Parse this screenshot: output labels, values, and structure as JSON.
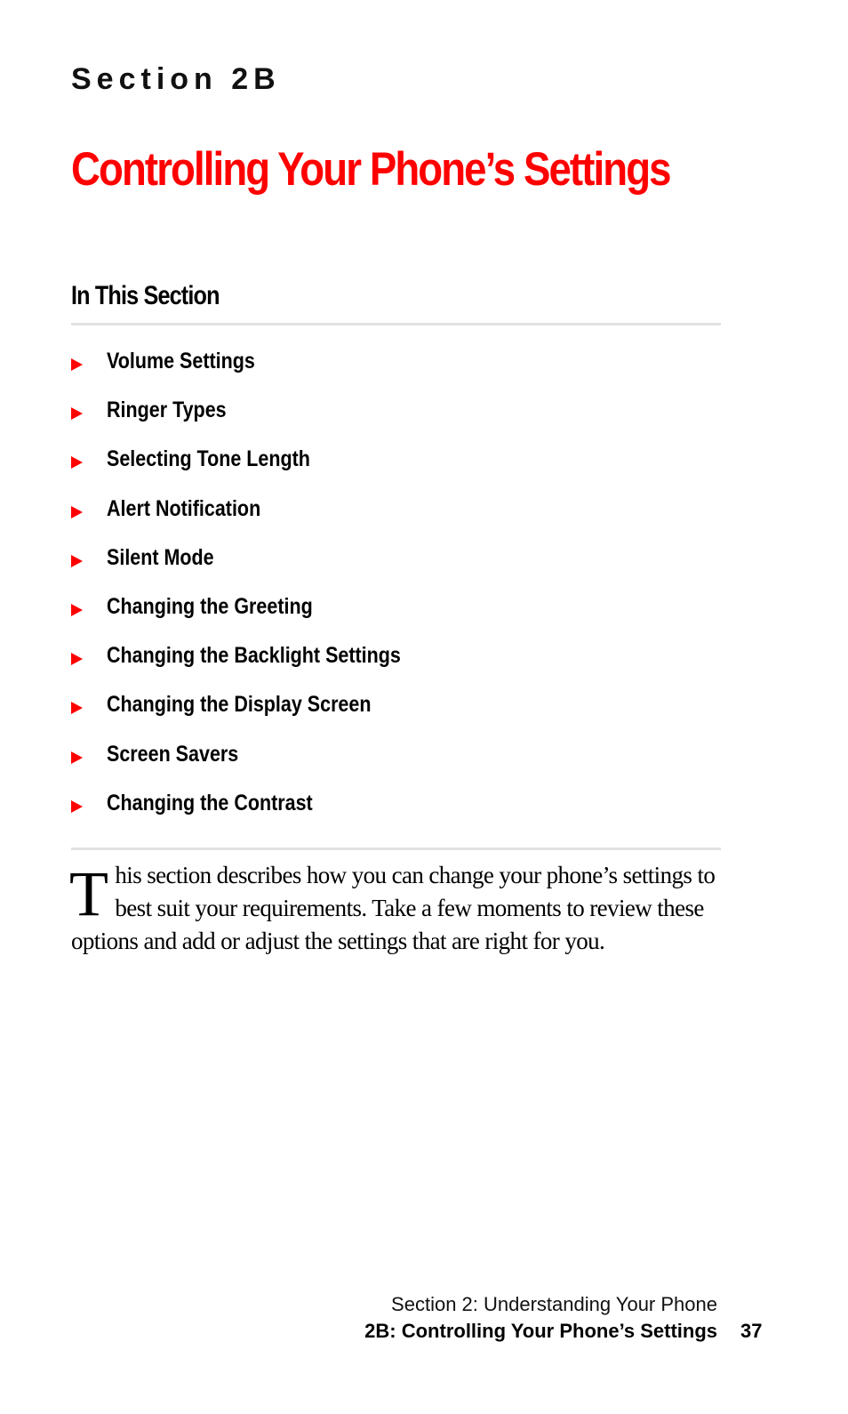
{
  "header": {
    "section_label": "Section 2B",
    "title": "Controlling Your Phone’s Settings"
  },
  "in_this_section": {
    "heading": "In This Section",
    "items": [
      {
        "label": "Volume Settings"
      },
      {
        "label": "Ringer Types"
      },
      {
        "label": "Selecting Tone Length"
      },
      {
        "label": "Alert Notification"
      },
      {
        "label": "Silent Mode"
      },
      {
        "label": "Changing the Greeting"
      },
      {
        "label": "Changing the Backlight Settings"
      },
      {
        "label": "Changing the Display Screen"
      },
      {
        "label": "Screen Savers"
      },
      {
        "label": "Changing the Contrast"
      }
    ]
  },
  "intro": {
    "drop_cap": "T",
    "text": "his section describes how you can change your phone’s settings to best suit your requirements. Take a few moments to review these options and add or adjust the settings that are right for you."
  },
  "footer": {
    "section": "Section 2: Understanding Your Phone",
    "chapter": "2B: Controlling Your Phone’s Settings",
    "page_number": "37"
  },
  "colors": {
    "accent": "#ff0000",
    "rule": "#e2e2e2"
  }
}
